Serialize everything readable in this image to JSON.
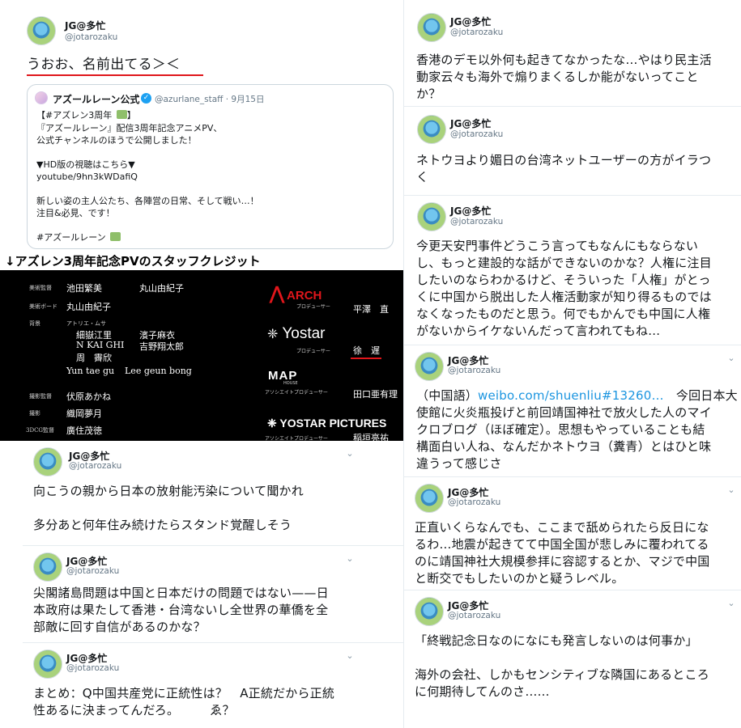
{
  "profile": {
    "name": "JG@多忙",
    "handle": "@jotarozaku"
  },
  "t1": {
    "text": "うおお、名前出てる＞＜",
    "quote": {
      "name": "アズールレーン公式",
      "handle_date": "@azurlane_staff · 9月15日",
      "lines": [
        "【#アズレン3周年 ",
        "『アズールレーン』配信3周年記念アニメPV、",
        "公式チャンネルのほうで公開しました！",
        "",
        "▼HD版の視聴はこちら▼",
        "youtube/9hn3kWDafiQ",
        "",
        "新しい姿の主人公たち、各陣営の日常、そして戦い…！",
        "注目&必見、です！",
        "",
        "#アズールレーン "
      ],
      "line1_suffix": "】"
    }
  },
  "caption": "↓アズレン3周年記念PVのスタッフクレジット",
  "credits": {
    "left": [
      {
        "role": "美術監督",
        "names": [
          "池田繁美",
          "丸山由紀子"
        ]
      },
      {
        "role": "美術ボード",
        "names": [
          "丸山由紀子"
        ]
      },
      {
        "role": "背景",
        "sub": "アトリエ・ムサ",
        "names": [
          "細嶽江里",
          "濱子麻衣",
          "N KAI GHI",
          "吉野翔太郎",
          "周　霽欣"
        ]
      },
      {
        "role": "",
        "names": [
          "Yun tae gu",
          "Lee geun bong"
        ]
      },
      {
        "role": "撮影監督",
        "names": [
          "伏原あかね"
        ]
      },
      {
        "role": "撮影",
        "names": [
          "織岡夢月"
        ]
      },
      {
        "role": "3DCG監督",
        "names": [
          "廣住茂徳"
        ]
      }
    ],
    "right": [
      {
        "logo": "ARCH",
        "role": "プロデューサー",
        "name": "平澤　直"
      },
      {
        "logo": "Yostar",
        "role": "プロデューサー",
        "name": "徐　遅"
      },
      {
        "logo": "MAP HOUSE",
        "role": "アソシエイトプロデューサー",
        "name": "田口亜有理"
      },
      {
        "logo": "YOSTAR PICTURES",
        "role": "アソシエイトプロデューサー",
        "name": "稲垣亮祐"
      }
    ]
  },
  "left_tweets": [
    {
      "id": "t2",
      "text": "向こうの親から日本の放射能汚染について聞かれ\n\n多分あと何年住み続けたらスタンド覚醒しそう"
    },
    {
      "id": "t3",
      "text": "尖閣諸島問題は中国と日本だけの問題ではない——日\n本政府は果たして香港・台湾ないし全世界の華僑を全\n部敵に回す自信があるのかな？"
    },
    {
      "id": "t4",
      "text": "まとめ：Q中国共産党に正統性は？　A正統だから正統\n性あるに決まってんだろ。　　　ゑ？"
    }
  ],
  "right_tweets": [
    {
      "id": "r1",
      "text": "香港のデモ以外何も起きてなかったな…やはり民主活\n動家云々も海外で煽りまくるしか能がないってこと\nか？"
    },
    {
      "id": "r2",
      "text": "ネトウヨより媚日の台湾ネットユーザーの方がイラつ\nく"
    },
    {
      "id": "r3",
      "text": "今更天安門事件どうこう言ってもなんにもならない\nし、もっと建設的な話ができないのかな？人権に注目\nしたいのならわかるけど、そういった「人権」がとっ\nくに中国から脱出した人権活動家が知り得るものでは\nなくなったものだと思う。何でもかんでも中国に人権\nがないからイケないんだって言われてもね…"
    },
    {
      "id": "r4",
      "prefix": "（中国語）",
      "link": "weibo.com/shuenliu#13260…",
      "rest": "　今回日本大\n使館に火炎瓶投げと前回靖国神社で放火した人のマイ\nクロブログ（ほぼ確定）。思想もやっていることも結\n構面白い人ね、なんだかネトウヨ（糞青）とはひと味\n違うって感じさ"
    },
    {
      "id": "r5",
      "text": "正直いくらなんでも、ここまで舐められたら反日にな\nるわ…地震が起きてて中国全国が悲しみに覆われてる\nのに靖国神社大規模参拝に容認するとか、マジで中国\nと断交でもしたいのかと疑うレベル。"
    },
    {
      "id": "r6",
      "text": "「終戦記念日なのになにも発言しないのは何事か」\n\n海外の会社、しかもセンシティブな隣国にあるところ\nに何期待してんのさ……"
    }
  ],
  "colors": {
    "link": "#1b95e0",
    "underline": "#e0161b",
    "verified": "#1da1f2"
  }
}
